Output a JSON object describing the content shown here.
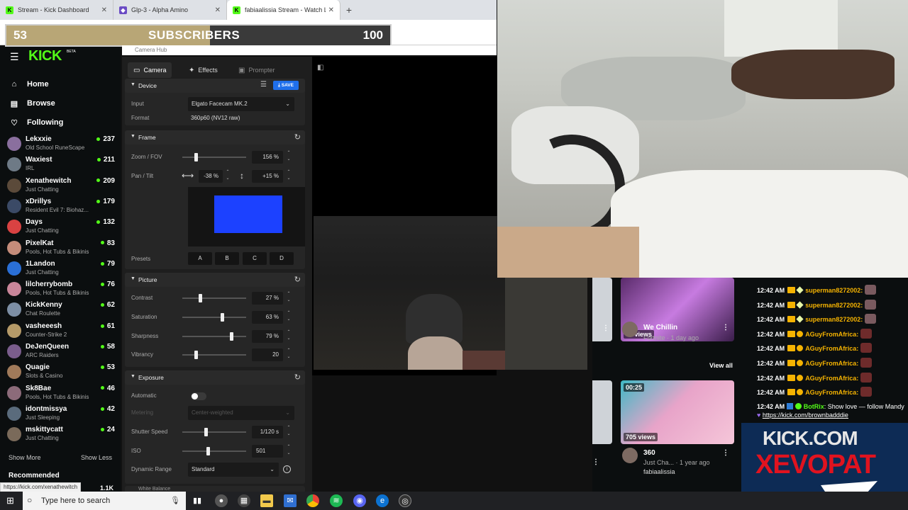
{
  "browser": {
    "tabs": [
      {
        "label": "Stream - Kick Dashboard",
        "active": false
      },
      {
        "label": "Glp-3 - Alpha Amino",
        "active": false
      },
      {
        "label": "fabiaalissia Stream - Watch Live",
        "active": true
      }
    ],
    "new_tab": "+",
    "tab_close": "✕",
    "status_url": "https://kick.com/xenathewitch"
  },
  "sub_goal": {
    "current": "53",
    "label": "SUBSCRIBERS",
    "goal": "100",
    "progress_fraction": 0.53
  },
  "kick_sidebar": {
    "logo": "KICK",
    "beta": "BETA",
    "nav": [
      {
        "label": "Home",
        "icon": "home-icon"
      },
      {
        "label": "Browse",
        "icon": "browse-icon"
      },
      {
        "label": "Following",
        "icon": "heart-icon"
      }
    ],
    "channels": [
      {
        "name": "Lekxxie",
        "category": "Old School RuneScape",
        "viewers": "237"
      },
      {
        "name": "Waxiest",
        "category": "IRL",
        "viewers": "211"
      },
      {
        "name": "Xenathewitch",
        "category": "Just Chatting",
        "viewers": "209"
      },
      {
        "name": "xDrillys",
        "category": "Resident Evil 7: Biohaz...",
        "viewers": "179"
      },
      {
        "name": "Days",
        "category": "Just Chatting",
        "viewers": "132"
      },
      {
        "name": "PixelKat",
        "category": "Pools, Hot Tubs & Bikinis",
        "viewers": "83"
      },
      {
        "name": "1Landon",
        "category": "Just Chatting",
        "viewers": "79"
      },
      {
        "name": "lilcherrybomb",
        "category": "Pools, Hot Tubs & Bikinis",
        "viewers": "76"
      },
      {
        "name": "KickKenny",
        "category": "Chat Roulette",
        "viewers": "62"
      },
      {
        "name": "vasheeesh",
        "category": "Counter-Strike 2",
        "viewers": "61"
      },
      {
        "name": "DeJenQueen",
        "category": "ARC Raiders",
        "viewers": "58"
      },
      {
        "name": "Quagie",
        "category": "Slots & Casino",
        "viewers": "53"
      },
      {
        "name": "Sk8Bae",
        "category": "Pools, Hot Tubs & Bikinis",
        "viewers": "46"
      },
      {
        "name": "idontmissya",
        "category": "Just Sleeping",
        "viewers": "42"
      },
      {
        "name": "mskittycatt",
        "category": "Just Chatting",
        "viewers": "24"
      }
    ],
    "show_more": "Show More",
    "show_less": "Show Less",
    "recommended": "Recommended",
    "peek_count": "1.1K"
  },
  "camera_hub": {
    "title": "Camera Hub",
    "tabs": [
      {
        "label": "Camera",
        "icon": "camera-icon"
      },
      {
        "label": "Effects",
        "icon": "effects-icon"
      },
      {
        "label": "Prompter",
        "icon": "prompter-icon"
      }
    ],
    "device": {
      "title": "Device",
      "save": "SAVE",
      "input_label": "Input",
      "input_value": "Elgato Facecam MK.2",
      "format_label": "Format",
      "format_value": "360p60 (NV12 raw)"
    },
    "frame": {
      "title": "Frame",
      "zoom_label": "Zoom / FOV",
      "zoom_value": "156 %",
      "zoom_level": 0.2,
      "pan_label": "Pan / Tilt",
      "pan_value": "-38 %",
      "tilt_value": "+15 %",
      "presets_label": "Presets",
      "presets": [
        "A",
        "B",
        "C",
        "D"
      ]
    },
    "picture": {
      "title": "Picture",
      "rows": [
        {
          "label": "Contrast",
          "value": "27 %",
          "level": 0.27
        },
        {
          "label": "Saturation",
          "value": "63 %",
          "level": 0.63
        },
        {
          "label": "Sharpness",
          "value": "79 %",
          "level": 0.79
        },
        {
          "label": "Vibrancy",
          "value": "20",
          "level": 0.2
        }
      ]
    },
    "exposure": {
      "title": "Exposure",
      "automatic_label": "Automatic",
      "metering_label": "Metering",
      "metering_value": "Center-weighted",
      "shutter_label": "Shutter Speed",
      "shutter_value": "1/120 s",
      "shutter_level": 0.36,
      "iso_label": "ISO",
      "iso_value": "501",
      "iso_level": 0.4,
      "dr_label": "Dynamic Range",
      "dr_value": "Standard"
    },
    "next_section": "White Balance"
  },
  "kick_page": {
    "clips": [
      {
        "badge": "90 views",
        "title": "We Chillin",
        "sub": "Fortnite · 1 day ago"
      },
      {
        "duration": "00:25",
        "badge": "705 views",
        "title": "360",
        "sub": "Just Cha... · 1 year ago",
        "channel": "fabiaalissia"
      }
    ],
    "view_all": "View all"
  },
  "chat": {
    "messages": [
      {
        "time": "12:42 AM",
        "user": "superman8272002:",
        "badge": "gem"
      },
      {
        "time": "12:42 AM",
        "user": "superman8272002:",
        "badge": "gem"
      },
      {
        "time": "12:42 AM",
        "user": "superman8272002:",
        "badge": "gem"
      },
      {
        "time": "12:42 AM",
        "user": "AGuyFromAfrica:",
        "badge": "coin"
      },
      {
        "time": "12:42 AM",
        "user": "AGuyFromAfrica:",
        "badge": "coin"
      },
      {
        "time": "12:42 AM",
        "user": "AGuyFromAfrica:",
        "badge": "coin"
      },
      {
        "time": "12:42 AM",
        "user": "AGuyFromAfrica:",
        "badge": "coin"
      },
      {
        "time": "12:42 AM",
        "user": "AGuyFromAfrica:",
        "badge": "coin"
      }
    ],
    "bot": {
      "time": "12:42 AM",
      "user": "BotRix",
      "text": ": Show love — follow Mandy",
      "link": "https://kick.com/brownbadddie"
    }
  },
  "banner": {
    "line1": "KICK.COM",
    "line2": "XEVOPAT"
  },
  "taskbar": {
    "search_placeholder": "Type here to search"
  },
  "colors": {
    "kick_green": "#53fc18",
    "chat_gold": "#f5b301",
    "save_blue": "#1f6feb",
    "banner_red": "#e0131f"
  }
}
